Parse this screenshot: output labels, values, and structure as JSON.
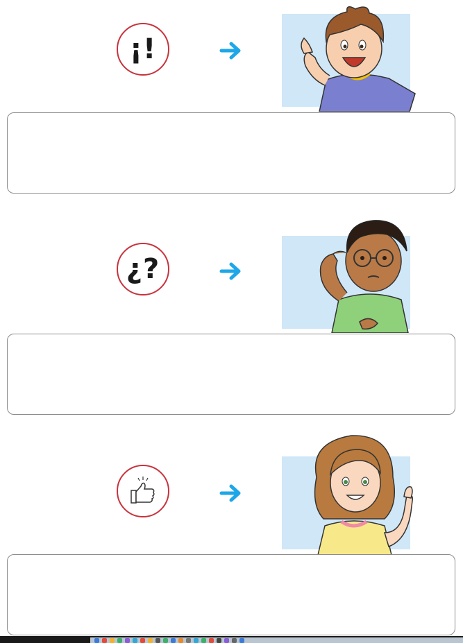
{
  "rows": [
    {
      "symbol": "¡!",
      "symbol_icon": "exclamation-marks-icon",
      "character": "boy-exclaiming"
    },
    {
      "symbol": "¿?",
      "symbol_icon": "question-marks-icon",
      "character": "boy-thinking"
    },
    {
      "symbol": "",
      "symbol_icon": "thumbs-up-icon",
      "character": "girl-thumbs-up"
    }
  ],
  "answers": [
    {
      "value": ""
    },
    {
      "value": ""
    },
    {
      "value": ""
    }
  ],
  "colors": {
    "circle_border": "#c8323c",
    "arrow": "#1ea7e8",
    "picture_bg": "#cfe7f7",
    "box_border": "#8c8c8c"
  }
}
